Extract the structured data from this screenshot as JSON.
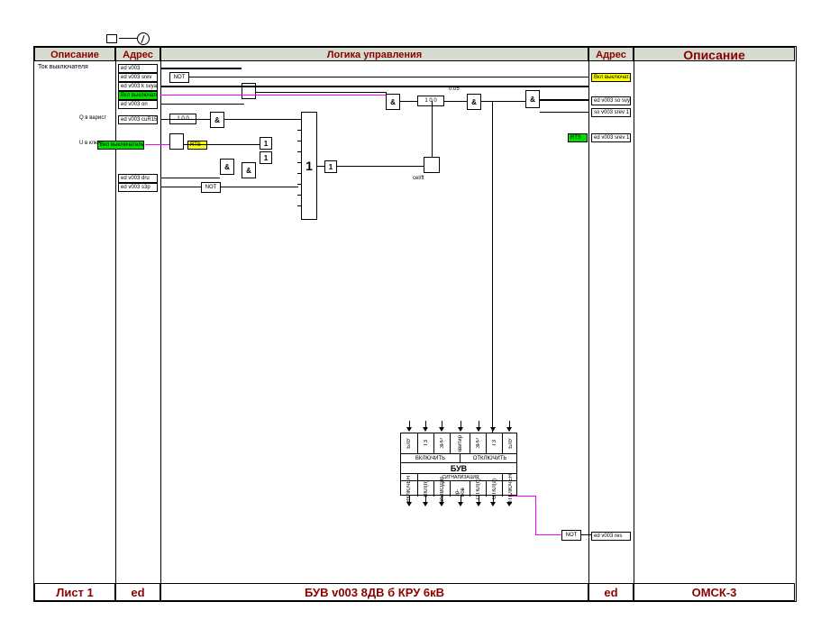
{
  "headers": {
    "desc_left": "Описание",
    "addr_left": "Адрес",
    "logic": "Логика управления",
    "addr_right": "Адрес",
    "desc_right": "Описание"
  },
  "footer": {
    "sheet": "Лист 1",
    "ed_left": "ed",
    "title": "БУВ v003  8ДВ б КРУ 6кВ",
    "ed_right": "ed",
    "site": "ОМСК-3"
  },
  "labels": {
    "tok": "Ток выключателя",
    "q_varist": "Q в варист",
    "u_vkluch": "U в ключ",
    "t_delay": "1    0    0",
    "cel_ft": "cel/ft"
  },
  "tags_left": [
    {
      "txt": "ed v003",
      "bg": ""
    },
    {
      "txt": "ed v003  srev",
      "bg": ""
    },
    {
      "txt": "ed v003  k  svyaz",
      "bg": ""
    },
    {
      "txt": "Вкл выключатель",
      "bg": "green"
    },
    {
      "txt": "ed v003  on",
      "bg": ""
    },
    {
      "txt": "ed v003  cuR151",
      "bg": ""
    },
    {
      "txt": "Вкл выключатель",
      "bg": "green"
    },
    {
      "txt": "ed v003  dru",
      "bg": ""
    },
    {
      "txt": "ed v003  s3p",
      "bg": ""
    }
  ],
  "tags_right": [
    {
      "txt": "Вкл выключат.",
      "bg": "yellow"
    },
    {
      "txt": "ed v003  so  svyaz",
      "bg": ""
    },
    {
      "txt": "so v003  srev  1",
      "bg": ""
    },
    {
      "txt": "ed v003  srev  1",
      "bg": ""
    },
    {
      "txt": "RTS",
      "bg": "green"
    },
    {
      "txt": "ed v003  res",
      "bg": ""
    }
  ],
  "tags_mid": [
    {
      "txt": "RTS",
      "bg": "yellow"
    }
  ],
  "blocks": {
    "not1": "NOT",
    "not2": "NOT",
    "not3": "NOT",
    "and": "&",
    "or": "1",
    "delay_0_05": "0.05"
  },
  "buv": {
    "title": "БУВ",
    "sig": "СИГНАЛИЗАЦИЯ",
    "on": "ВКЛЮЧИТЬ",
    "off": "ОТКЛЮЧИТЬ",
    "top_cols": [
      "БЛУ",
      "ТЗ",
      "ЗРР",
      "квитир",
      "ЗРР",
      "ТЗ",
      "БЛУ"
    ],
    "bot_cols": [
      "ВКЛЮЧЕН",
      "ВКЛ(п)",
      "ВЫВОД(В",
      "зр-нов",
      "ОТКЛ(п)",
      "ОТКЛ(а)",
      "ОТКЛЮЧЕН"
    ]
  }
}
